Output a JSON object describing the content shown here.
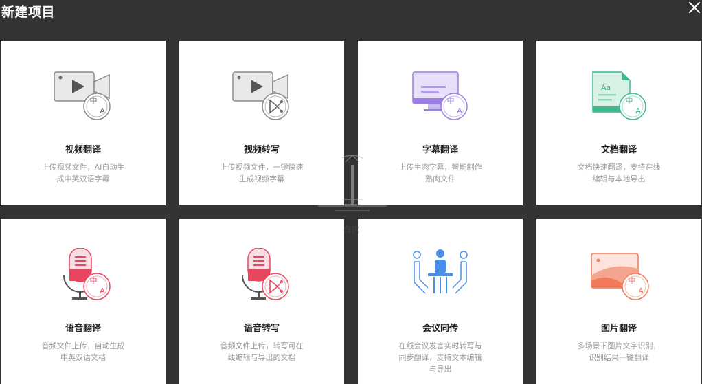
{
  "header": {
    "title": "新建项目"
  },
  "watermark_text": "有内",
  "cards": [
    {
      "title": "视频翻译",
      "desc": "上传视频文件，AI自动生成中英双语字幕"
    },
    {
      "title": "视频转写",
      "desc": "上传视频文件，一键快速生成视频字幕"
    },
    {
      "title": "字幕翻译",
      "desc": "上传生肉字幕，智能制作熟肉文件"
    },
    {
      "title": "文档翻译",
      "desc": "文档快速翻译，支持在线编辑与本地导出"
    },
    {
      "title": "语音翻译",
      "desc": "音频文件上传，自动生成中英双语文档"
    },
    {
      "title": "语音转写",
      "desc": "音频文件上传，转写可在线编辑与导出的文档"
    },
    {
      "title": "会议同传",
      "desc": "在线会议发言实时转写与同步翻译，支持文本编辑与导出"
    },
    {
      "title": "图片翻译",
      "desc": "多场景下图片文字识别，识别结果一键翻译"
    }
  ],
  "badge": {
    "zh": "中",
    "en": "A"
  },
  "icons": {
    "video-translate": "video-camera-translate-icon",
    "video-transcribe": "video-camera-transcribe-icon",
    "subtitle-translate": "monitor-translate-icon",
    "document-translate": "document-translate-icon",
    "audio-translate": "microphone-translate-icon",
    "audio-transcribe": "microphone-transcribe-icon",
    "meeting": "meeting-icon",
    "image-translate": "image-translate-icon"
  },
  "colors": {
    "background": "#333333",
    "card": "#ffffff",
    "gray_icon": "#8a8a8a",
    "purple": "#9b7fe6",
    "green": "#3cb98a",
    "red": "#e8455e",
    "blue": "#4a8fe7",
    "orange": "#f07a5a"
  }
}
